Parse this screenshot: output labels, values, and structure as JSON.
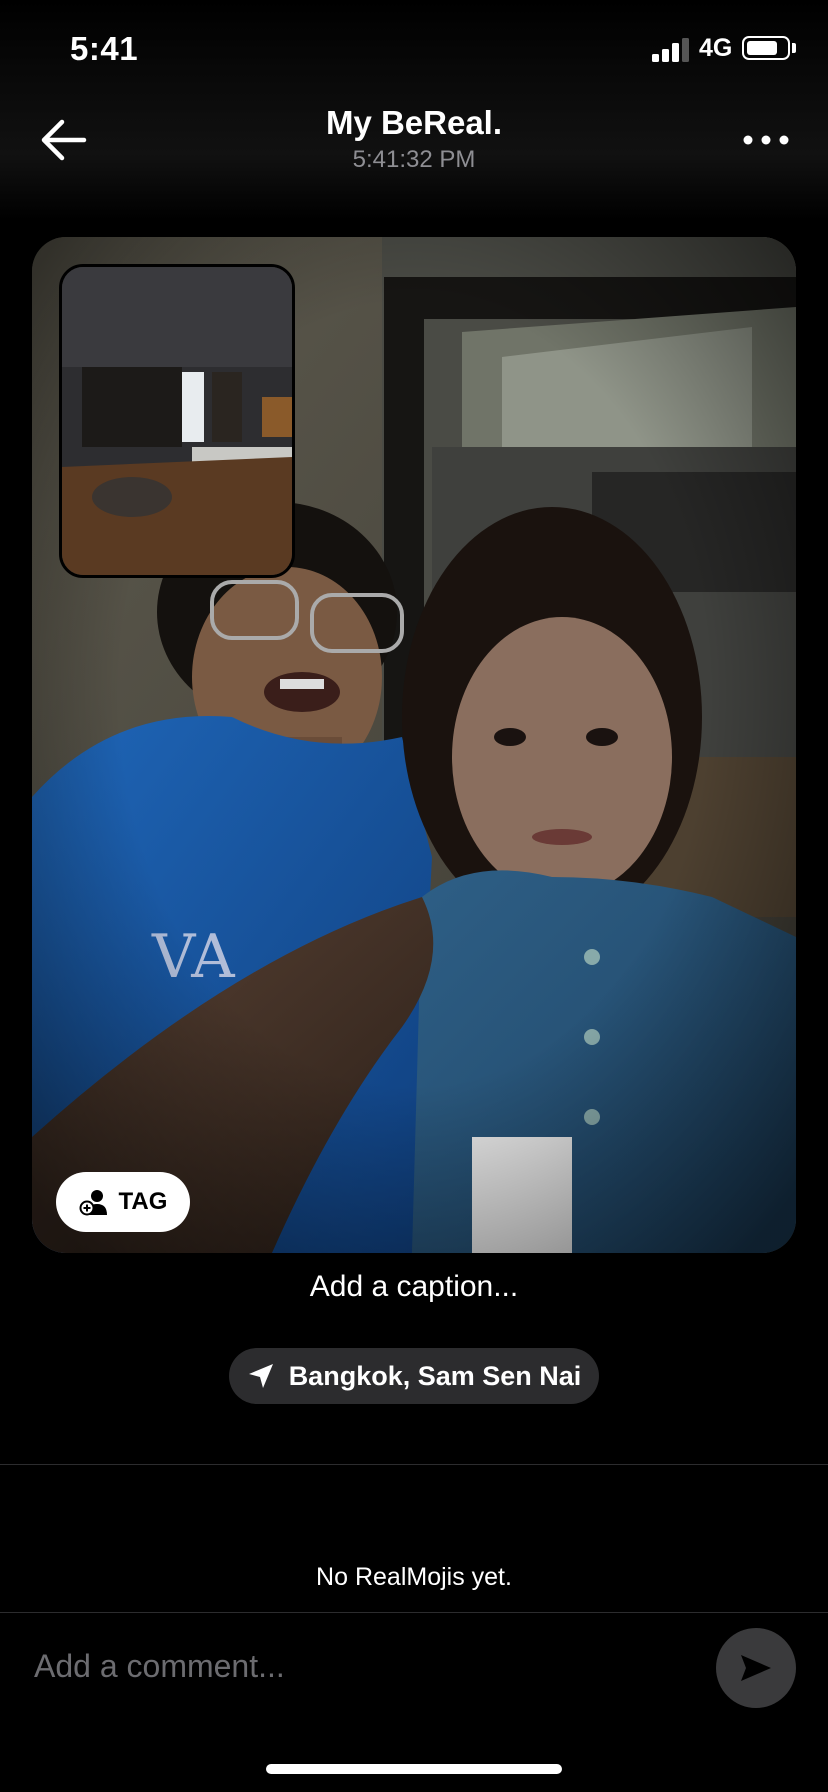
{
  "status_bar": {
    "time": "5:41",
    "network": "4G",
    "battery_level": 0.8
  },
  "header": {
    "title": "My BeReal.",
    "timestamp": "5:41:32 PM",
    "back_icon": "arrow-left-icon",
    "more_icon": "ellipsis-icon"
  },
  "photo": {
    "tag_label": "TAG",
    "tag_icon": "add-person-icon"
  },
  "caption": {
    "placeholder": "Add a caption..."
  },
  "location": {
    "label": "Bangkok, Sam Sen Nai",
    "icon": "location-arrow-icon"
  },
  "realmojis": {
    "empty_text": "No RealMojis yet."
  },
  "comment": {
    "placeholder": "Add a comment...",
    "send_icon": "send-icon"
  },
  "colors": {
    "background": "#000000",
    "pill": "#2c2c2e",
    "secondary_text": "#8e8e93"
  }
}
